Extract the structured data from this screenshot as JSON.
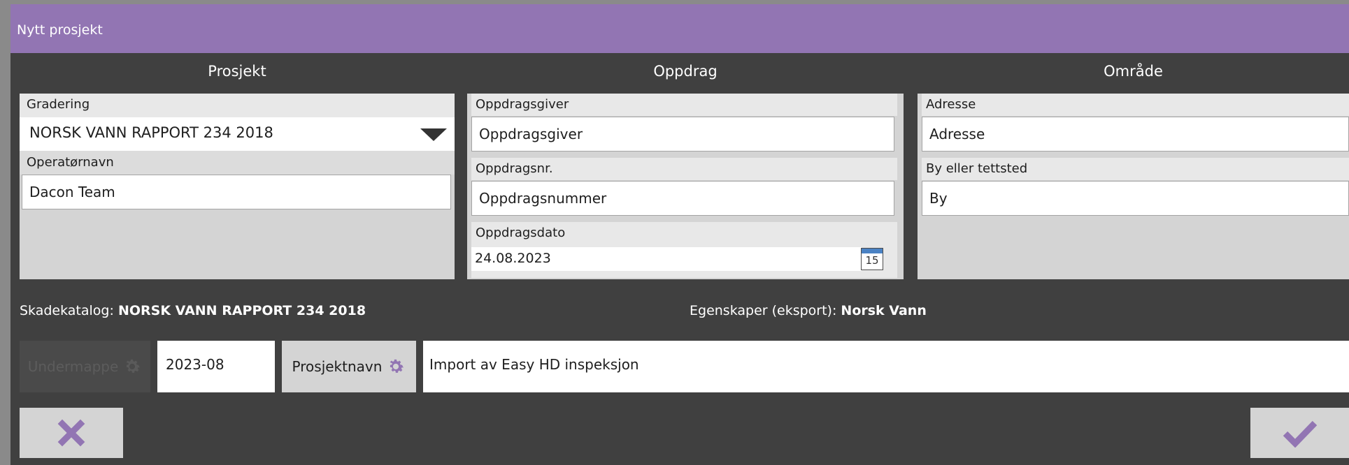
{
  "window": {
    "title": "Nytt prosjekt"
  },
  "sections": {
    "prosjekt": "Prosjekt",
    "oppdrag": "Oppdrag",
    "omrade": "Område"
  },
  "prosjekt": {
    "gradering_label": "Gradering",
    "gradering_value": "NORSK VANN RAPPORT 234 2018",
    "operator_label": "Operatørnavn",
    "operator_value": "Dacon Team"
  },
  "oppdrag": {
    "giver_label": "Oppdragsgiver",
    "giver_value": "Oppdragsgiver",
    "nr_label": "Oppdragsnr.",
    "nr_value": "Oppdragsnummer",
    "dato_label": "Oppdragsdato",
    "dato_value": "24.08.2023",
    "calendar_day": "15"
  },
  "omrade": {
    "adresse_label": "Adresse",
    "adresse_value": "Adresse",
    "by_label": "By eller tettsted",
    "by_value": "By"
  },
  "info": {
    "skadekatalog_label": "Skadekatalog:",
    "skadekatalog_value": "NORSK VANN RAPPORT 234 2018",
    "egenskaper_label": "Egenskaper (eksport):",
    "egenskaper_value": "Norsk Vann"
  },
  "naming": {
    "undermappe_label": "Undermappe",
    "date_value": "2023-08",
    "prosjektnavn_label": "Prosjektnavn",
    "project_name_value": "Import av Easy HD inspeksjon"
  },
  "colors": {
    "accent": "#9275b3",
    "background": "#404040",
    "panel": "#d4d4d4"
  },
  "icons": {
    "cancel": "close-icon",
    "confirm": "checkmark-icon",
    "dropdown": "chevron-down-icon",
    "calendar": "calendar-icon",
    "settings": "gear-icon"
  }
}
